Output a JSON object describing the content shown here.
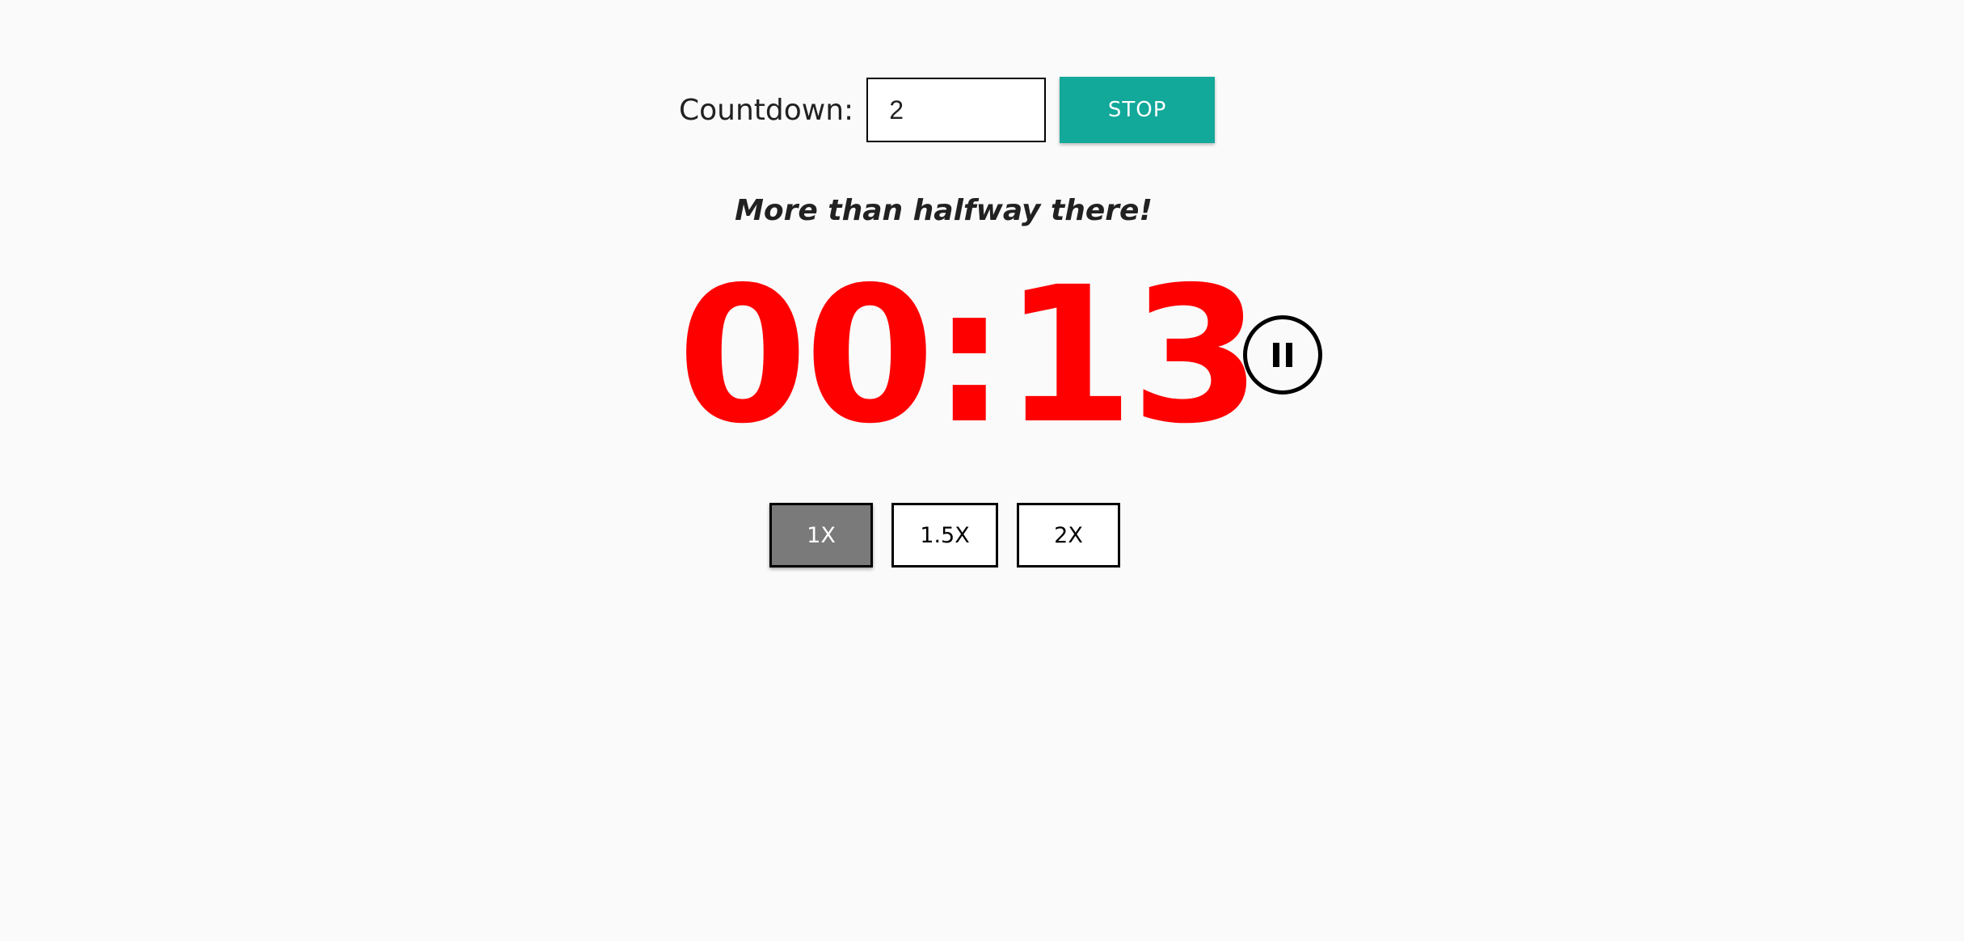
{
  "countdown": {
    "label": "Countdown:",
    "input_value": "2",
    "stop_label": "STOP"
  },
  "message": "More than halfway there!",
  "timer": {
    "display": "00:13",
    "color": "#ff0000"
  },
  "pause": {
    "icon": "pause-icon"
  },
  "speeds": [
    {
      "label": "1X",
      "active": true
    },
    {
      "label": "1.5X",
      "active": false
    },
    {
      "label": "2X",
      "active": false
    }
  ],
  "colors": {
    "accent": "#12a89a",
    "active_speed": "#7a7a7a",
    "background": "#fafafa"
  }
}
